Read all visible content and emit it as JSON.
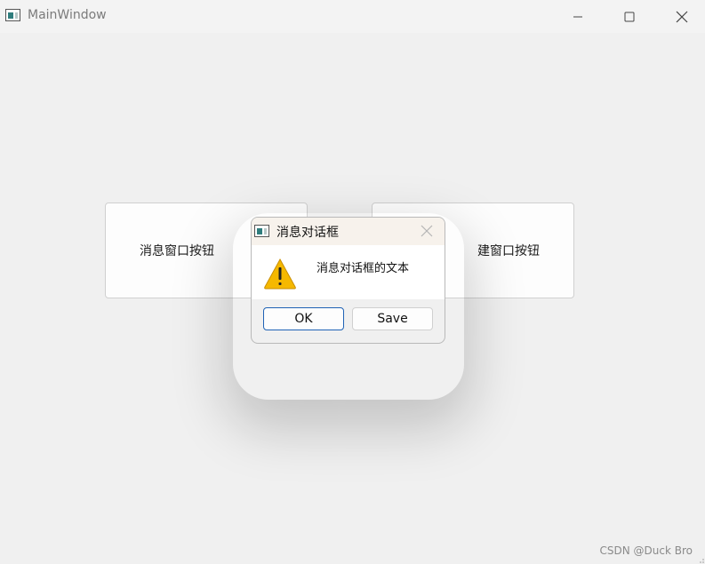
{
  "window": {
    "title": "MainWindow",
    "controls": {
      "minimize": "minimize-icon",
      "maximize": "maximize-icon",
      "close": "close-icon"
    }
  },
  "main": {
    "left_button_label": "消息窗口按钮",
    "right_button_label": "建窗口按钮"
  },
  "dialog": {
    "title": "消息对话框",
    "message": "消息对话框的文本",
    "icon": "warning-icon",
    "buttons": {
      "ok": "OK",
      "save": "Save"
    }
  },
  "watermark": "CSDN @Duck Bro",
  "colors": {
    "accent": "#1f62b5",
    "warning": "#f5b800"
  }
}
